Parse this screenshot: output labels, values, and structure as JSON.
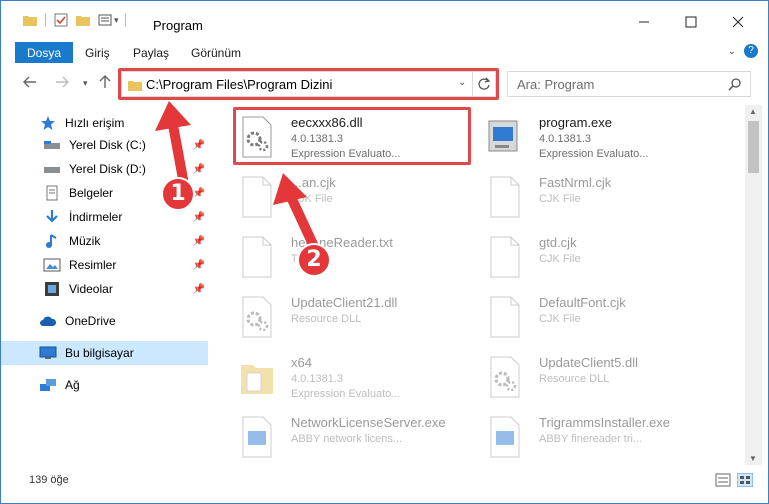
{
  "window": {
    "title": "Program"
  },
  "ribbon": {
    "tabs": [
      "Dosya",
      "Giriş",
      "Paylaş",
      "Görünüm"
    ]
  },
  "address": {
    "path": "C:\\Program Files\\Program Dizini"
  },
  "search": {
    "placeholder": "Ara: Program"
  },
  "sidebar": {
    "items": [
      {
        "label": "Hızlı erişim",
        "icon": "star-icon"
      },
      {
        "label": "Yerel Disk (C:)",
        "icon": "drive-icon"
      },
      {
        "label": "Yerel Disk (D:)",
        "icon": "drive-icon"
      },
      {
        "label": "Belgeler",
        "icon": "documents-icon"
      },
      {
        "label": "İndirmeler",
        "icon": "download-icon"
      },
      {
        "label": "Müzik",
        "icon": "music-icon"
      },
      {
        "label": "Resimler",
        "icon": "pictures-icon"
      },
      {
        "label": "Videolar",
        "icon": "video-icon"
      },
      {
        "label": "OneDrive",
        "icon": "cloud-icon"
      },
      {
        "label": "Bu bilgisayar",
        "icon": "computer-icon"
      },
      {
        "label": "Ağ",
        "icon": "network-icon"
      }
    ]
  },
  "files": [
    {
      "name": "eecxxx86.dll",
      "sub1": "4.0.1381.3",
      "sub2": "Expression Evaluato...",
      "icon": "dll-icon"
    },
    {
      "name": "program.exe",
      "sub1": "4.0.1381.3",
      "sub2": "Expression Evaluato...",
      "icon": "exe-icon"
    },
    {
      "name": "...an.cjk",
      "sub1": "CJK File",
      "sub2": "",
      "icon": "file-icon"
    },
    {
      "name": "FastNrml.cjk",
      "sub1": "CJK File",
      "sub2": "",
      "icon": "file-icon"
    },
    {
      "name": "hel...neReader.txt",
      "sub1": "Te...",
      "sub2": "",
      "icon": "file-icon"
    },
    {
      "name": "gtd.cjk",
      "sub1": "CJK File",
      "sub2": "",
      "icon": "file-icon"
    },
    {
      "name": "UpdateClient21.dll",
      "sub1": "Resource DLL",
      "sub2": "",
      "icon": "dll-icon"
    },
    {
      "name": "DefaultFont.cjk",
      "sub1": "CJK File",
      "sub2": "",
      "icon": "file-icon"
    },
    {
      "name": "x64",
      "sub1": "4.0.1381.3",
      "sub2": "Expression Evaluato...",
      "icon": "folder-icon"
    },
    {
      "name": "UpdateClient5.dll",
      "sub1": "Resource DLL",
      "sub2": "",
      "icon": "dll-icon"
    },
    {
      "name": "NetworkLicenseServer.exe",
      "sub1": "ABBY network licens...",
      "sub2": "",
      "icon": "app-icon"
    },
    {
      "name": "TrigrammsInstaller.exe",
      "sub1": "ABBY finereader tri...",
      "sub2": "",
      "icon": "app-icon"
    }
  ],
  "status": {
    "count": "139 öğe"
  },
  "annotations": {
    "badge1": "1",
    "badge2": "2"
  },
  "colors": {
    "accent": "#1979ca",
    "highlight": "#e0484a",
    "selected": "#cce8ff"
  }
}
